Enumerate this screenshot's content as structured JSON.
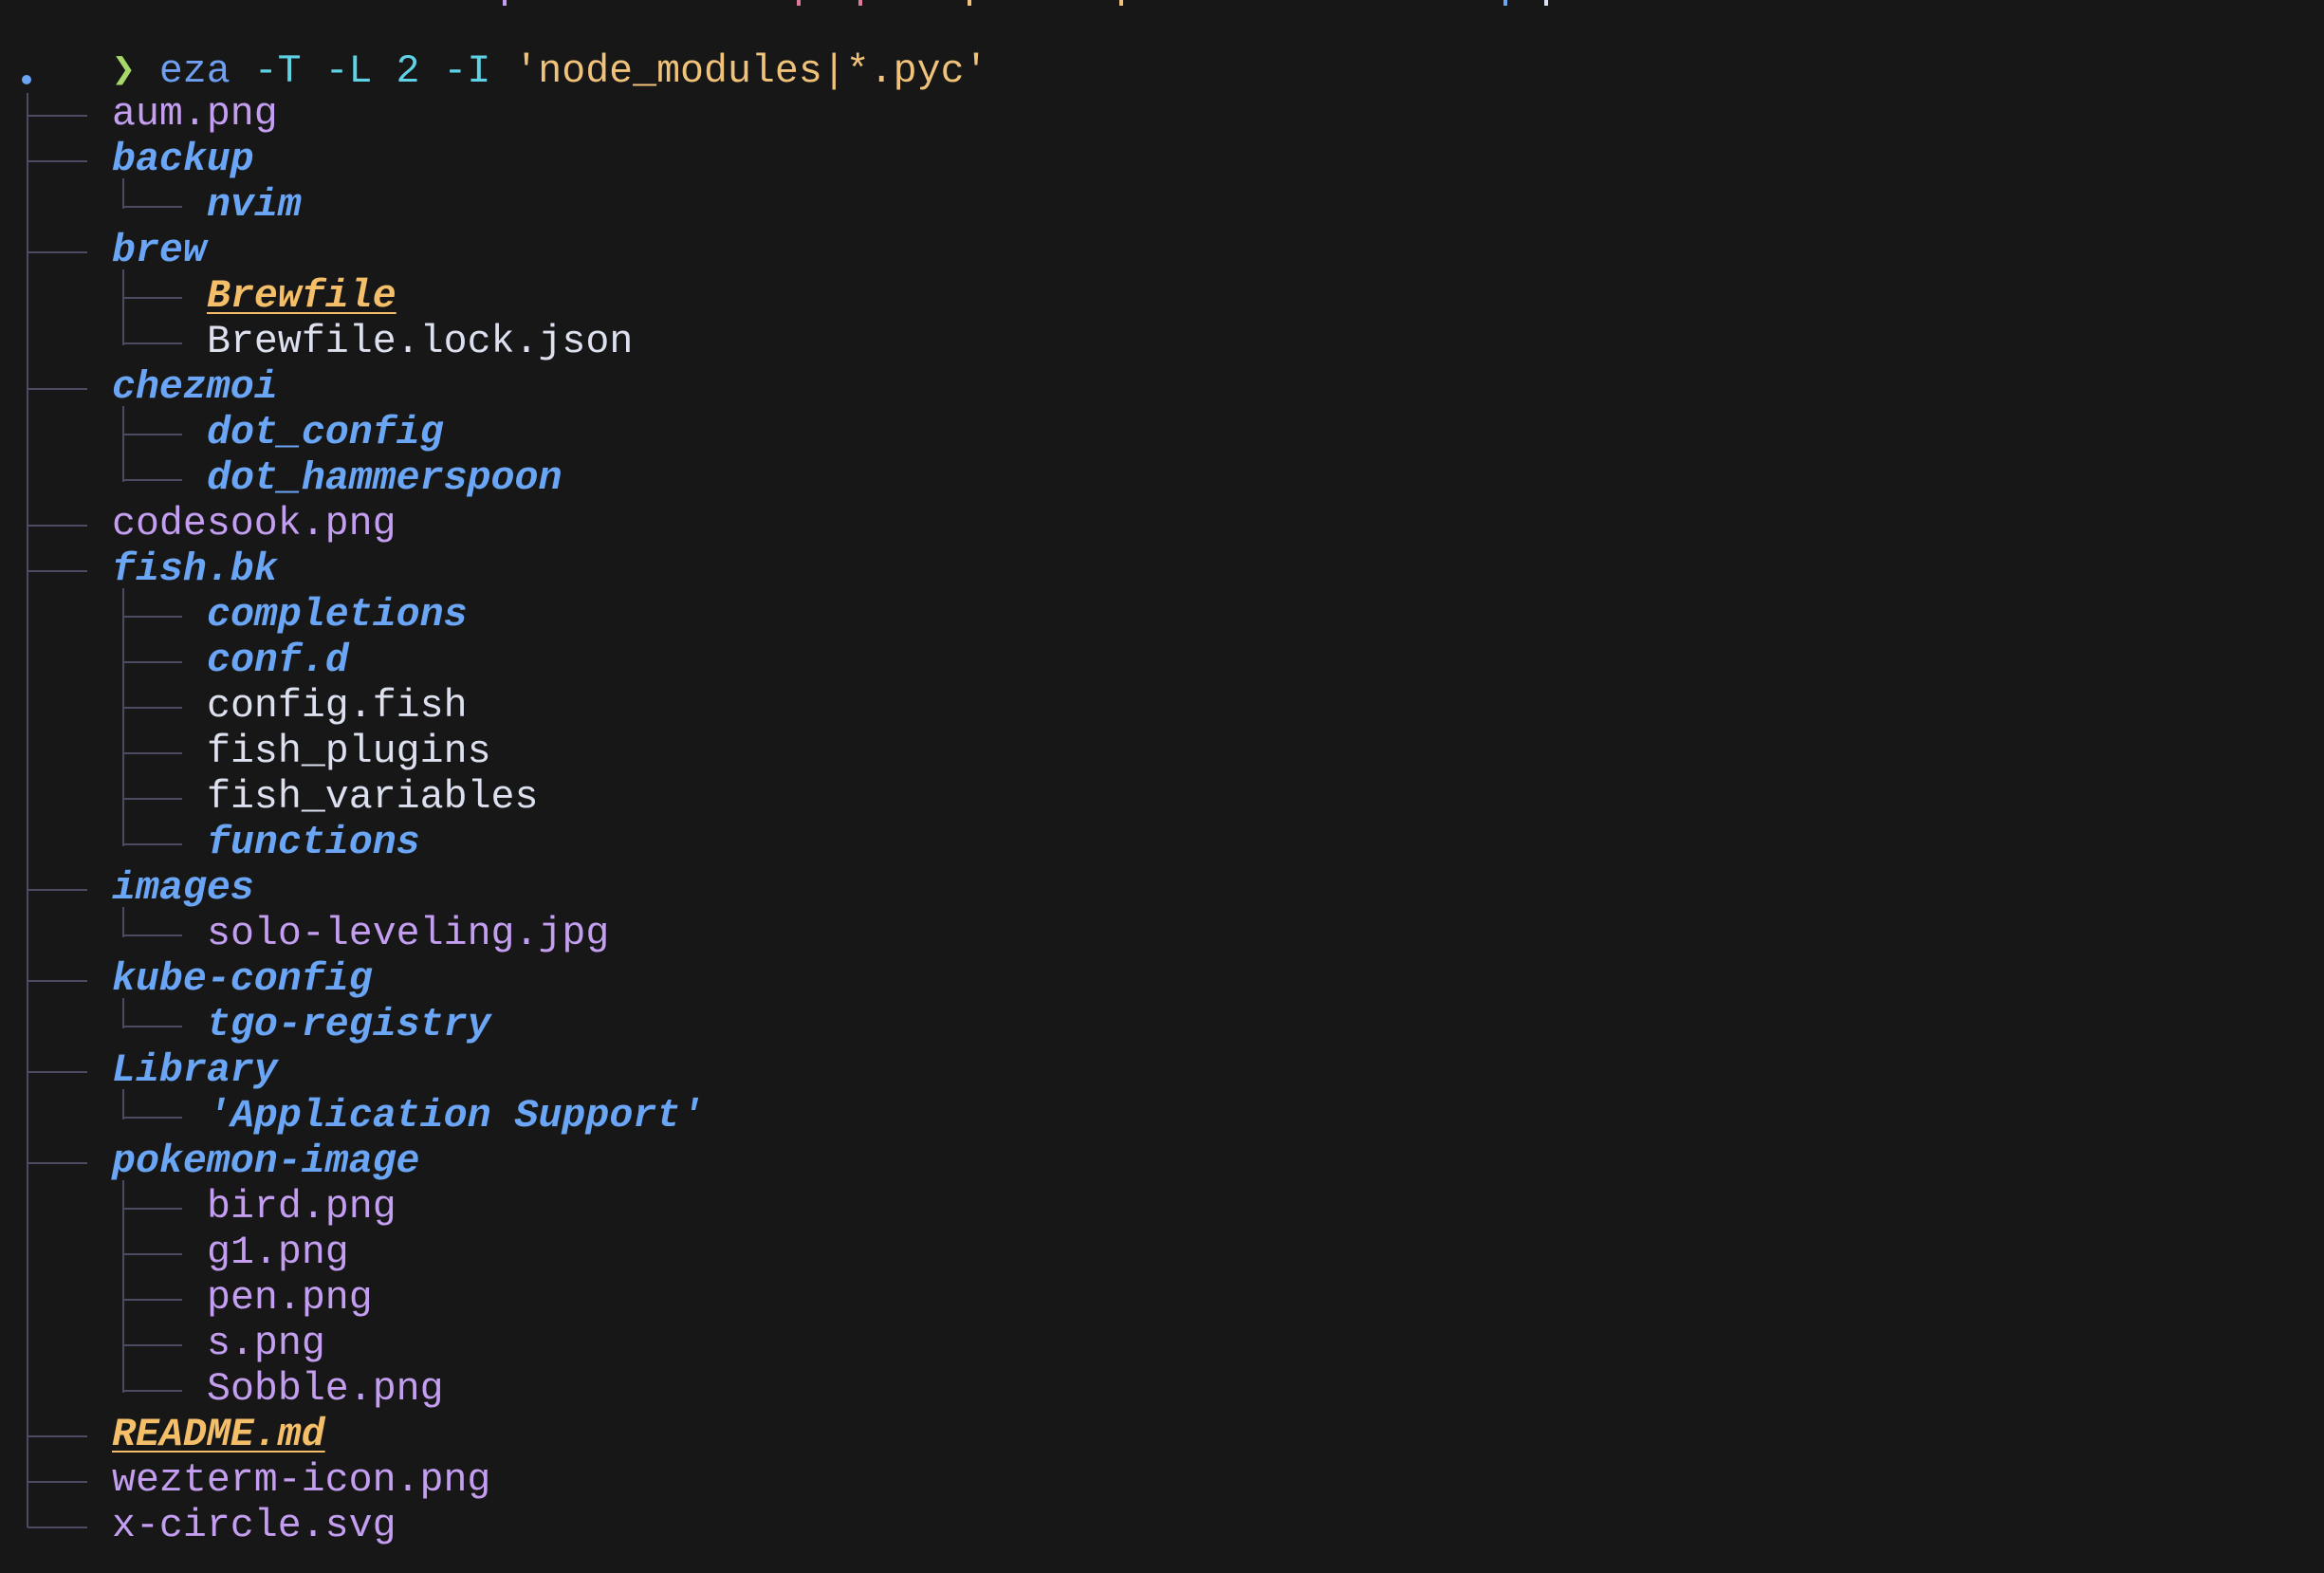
{
  "terminal": {
    "background": "#171717",
    "prompt": {
      "symbol": "❯",
      "command": "eza",
      "flags": [
        "-T",
        "-L",
        "2",
        "-I"
      ],
      "ignore_pattern": "'node_modules|*.pyc'",
      "colors": {
        "symbol": "#a6d96a",
        "command": "#6e9ff0",
        "flags": "#5fd3e6",
        "string": "#f0c27a"
      }
    },
    "tree": {
      "root": ".",
      "entries": [
        {
          "name": "aum.png",
          "depth": 1,
          "kind": "image",
          "last": false
        },
        {
          "name": "backup",
          "depth": 1,
          "kind": "dir",
          "last": false
        },
        {
          "name": "nvim",
          "depth": 2,
          "kind": "dir",
          "last": true
        },
        {
          "name": "brew",
          "depth": 1,
          "kind": "dir",
          "last": false
        },
        {
          "name": "Brewfile",
          "depth": 2,
          "kind": "special",
          "last": false
        },
        {
          "name": "Brewfile.lock.json",
          "depth": 2,
          "kind": "file",
          "last": true
        },
        {
          "name": "chezmoi",
          "depth": 1,
          "kind": "dir",
          "last": false
        },
        {
          "name": "dot_config",
          "depth": 2,
          "kind": "dir",
          "last": false
        },
        {
          "name": "dot_hammerspoon",
          "depth": 2,
          "kind": "dir",
          "last": true
        },
        {
          "name": "codesook.png",
          "depth": 1,
          "kind": "image",
          "last": false
        },
        {
          "name": "fish.bk",
          "depth": 1,
          "kind": "dir",
          "last": false
        },
        {
          "name": "completions",
          "depth": 2,
          "kind": "dir",
          "last": false
        },
        {
          "name": "conf.d",
          "depth": 2,
          "kind": "dir",
          "last": false
        },
        {
          "name": "config.fish",
          "depth": 2,
          "kind": "file",
          "last": false
        },
        {
          "name": "fish_plugins",
          "depth": 2,
          "kind": "file",
          "last": false
        },
        {
          "name": "fish_variables",
          "depth": 2,
          "kind": "file",
          "last": false
        },
        {
          "name": "functions",
          "depth": 2,
          "kind": "dir",
          "last": true
        },
        {
          "name": "images",
          "depth": 1,
          "kind": "dir",
          "last": false
        },
        {
          "name": "solo-leveling.jpg",
          "depth": 2,
          "kind": "image",
          "last": true
        },
        {
          "name": "kube-config",
          "depth": 1,
          "kind": "dir",
          "last": false
        },
        {
          "name": "tgo-registry",
          "depth": 2,
          "kind": "dir",
          "last": true
        },
        {
          "name": "Library",
          "depth": 1,
          "kind": "dir",
          "last": false
        },
        {
          "name": "'Application Support'",
          "depth": 2,
          "kind": "dir",
          "last": true
        },
        {
          "name": "pokemon-image",
          "depth": 1,
          "kind": "dir",
          "last": false
        },
        {
          "name": "bird.png",
          "depth": 2,
          "kind": "image",
          "last": false
        },
        {
          "name": "g1.png",
          "depth": 2,
          "kind": "image",
          "last": false
        },
        {
          "name": "pen.png",
          "depth": 2,
          "kind": "image",
          "last": false
        },
        {
          "name": "s.png",
          "depth": 2,
          "kind": "image",
          "last": false
        },
        {
          "name": "Sobble.png",
          "depth": 2,
          "kind": "image",
          "last": true
        },
        {
          "name": "README.md",
          "depth": 1,
          "kind": "special",
          "last": false
        },
        {
          "name": "wezterm-icon.png",
          "depth": 1,
          "kind": "image",
          "last": false
        },
        {
          "name": "x-circle.svg",
          "depth": 1,
          "kind": "image",
          "last": true
        }
      ],
      "colors": {
        "dir": "#6aa6f5",
        "image": "#c49ef0",
        "file": "#dde0ee",
        "special": "#f5bf6a",
        "connector": "#4b4b63"
      }
    }
  }
}
